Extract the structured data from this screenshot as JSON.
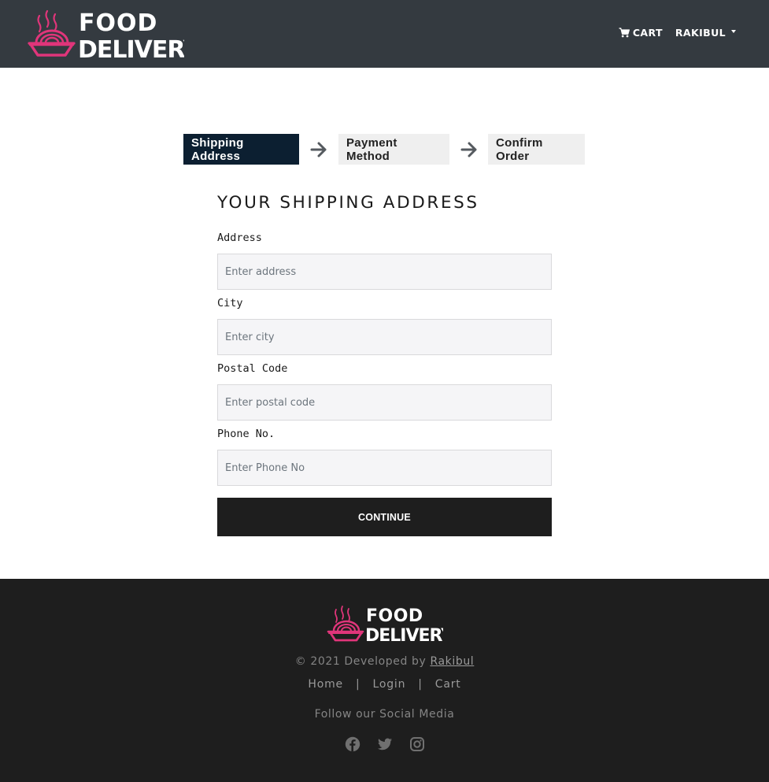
{
  "navbar": {
    "brand_line1": "FOOD",
    "brand_line2": "DELIVERY",
    "cart_label": "CART",
    "user_label": "RAKIBUL",
    "cart_icon": "shopping-cart-icon"
  },
  "steps": [
    {
      "label": "Shipping Address",
      "state": "active"
    },
    {
      "label": "Payment Method",
      "state": "inactive"
    },
    {
      "label": "Confirm Order",
      "state": "inactive"
    }
  ],
  "form": {
    "title": "YOUR SHIPPING ADDRESS",
    "fields": [
      {
        "label": "Address",
        "placeholder": "Enter address",
        "value": ""
      },
      {
        "label": "City",
        "placeholder": "Enter city",
        "value": ""
      },
      {
        "label": "Postal Code",
        "placeholder": "Enter postal code",
        "value": ""
      },
      {
        "label": "Phone No.",
        "placeholder": "Enter Phone No",
        "value": ""
      }
    ],
    "submit_label": "CONTINUE"
  },
  "footer": {
    "brand_line1": "FOOD",
    "brand_line2": "DELIVERY",
    "copyright_prefix": "© 2021 Developed by ",
    "developer": "Rakibul",
    "links": [
      "Home",
      "Login",
      "Cart"
    ],
    "separator": "|",
    "follow_text": "Follow our Social Media",
    "social_icons": [
      "facebook-icon",
      "twitter-icon",
      "instagram-icon"
    ]
  },
  "colors": {
    "navbar_bg": "#343a40",
    "brand_accent": "#e0357a",
    "step_active_bg": "#0c1f31",
    "step_inactive_bg": "#efefef",
    "button_bg": "#1e1e1e",
    "footer_bg": "#1e1e1e",
    "input_bg": "#f5f5f7"
  }
}
